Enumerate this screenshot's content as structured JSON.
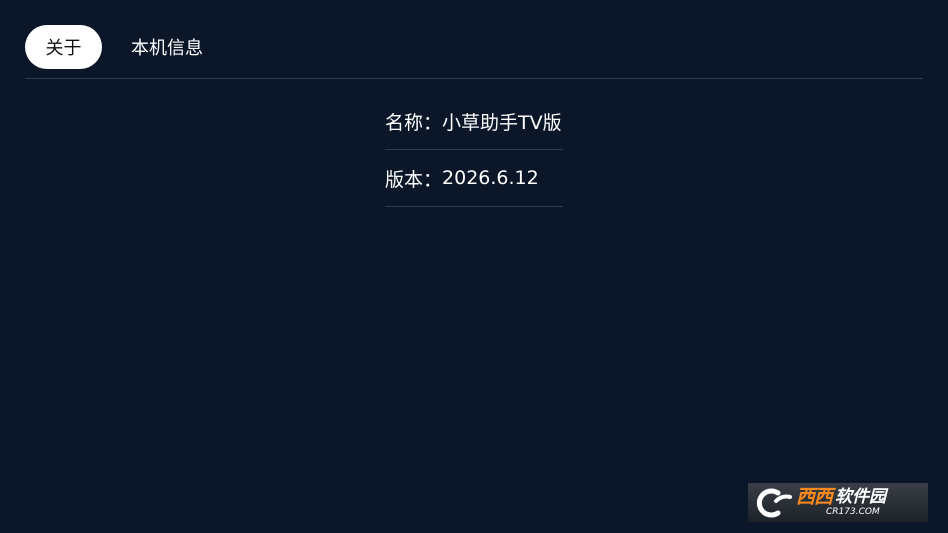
{
  "tabs": [
    {
      "label": "关于",
      "active": true
    },
    {
      "label": "本机信息",
      "active": false
    }
  ],
  "about": {
    "rows": [
      {
        "label": "名称：",
        "value": "小草助手TV版"
      },
      {
        "label": "版本：",
        "value": "2026.6.12"
      }
    ]
  },
  "watermark": {
    "logo_icon": "cr-logo-icon",
    "title_orange": "西西",
    "title_white": "软件园",
    "url": "CR173.COM"
  },
  "colors": {
    "background": "#0b1629",
    "divider": "#2e3a4d",
    "active_tab_bg": "#ffffff",
    "active_tab_text": "#111111",
    "text": "#ffffff"
  }
}
